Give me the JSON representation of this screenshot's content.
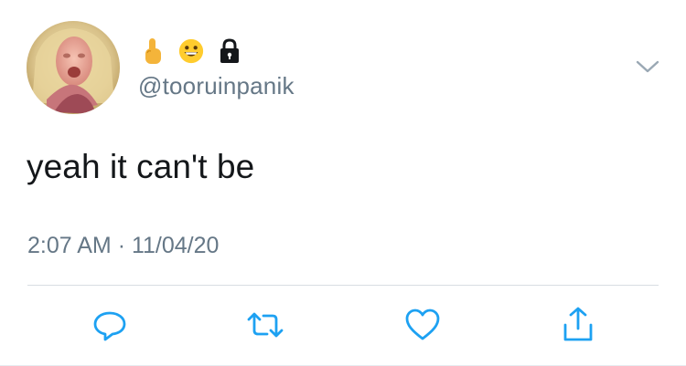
{
  "author": {
    "avatar_icon": "profile-photo",
    "name_emojis": [
      "pointing-finger-emoji",
      "grinning-face-emoji",
      "lock-icon"
    ],
    "handle": "@tooruinpanik"
  },
  "tweet": {
    "text": "yeah it can't be",
    "time": "2:07 AM",
    "separator": "·",
    "date": "11/04/20"
  },
  "actions": [
    "reply-icon",
    "retweet-icon",
    "like-icon",
    "share-icon"
  ],
  "colors": {
    "text": "#14171a",
    "secondary": "#657786",
    "icon": "#1da1f2",
    "divider": "#d8dde2"
  }
}
